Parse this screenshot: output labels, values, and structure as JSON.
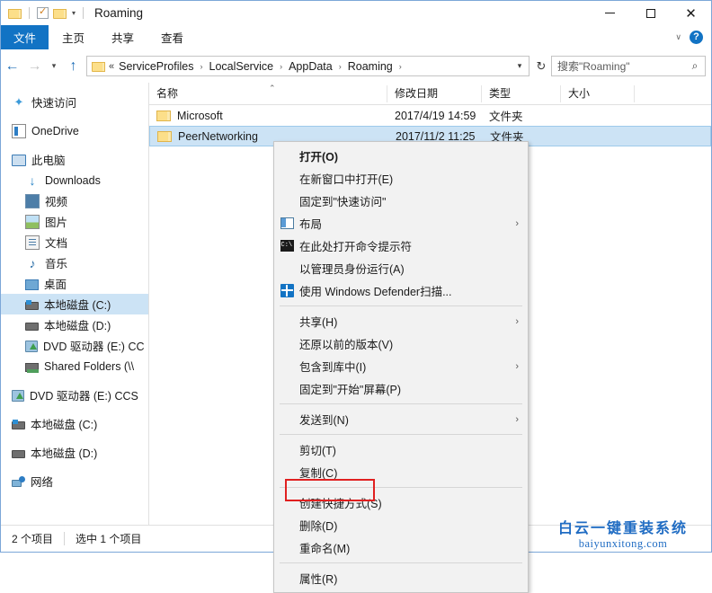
{
  "window": {
    "title": "Roaming",
    "quick_access": [
      {
        "name": "folder-icon",
        "label": "文件夹"
      },
      {
        "name": "properties-icon",
        "label": "属性"
      },
      {
        "name": "new-folder-icon",
        "label": "新建文件夹"
      },
      {
        "name": "customize-caret-icon",
        "label": "自定义快速访问工具栏"
      }
    ],
    "controls": {
      "minimize": "—",
      "maximize": "□",
      "close": "✕"
    }
  },
  "ribbon": {
    "tabs": [
      {
        "label": "文件",
        "active": true
      },
      {
        "label": "主页",
        "active": false
      },
      {
        "label": "共享",
        "active": false
      },
      {
        "label": "查看",
        "active": false
      }
    ],
    "collapse_icon": "∨",
    "help_icon": "?"
  },
  "address": {
    "back_icon": "←",
    "forward_icon": "→",
    "recent_icon": "∨",
    "up_icon": "↑",
    "lead": "«",
    "breadcrumbs": [
      "ServiceProfiles",
      "LocalService",
      "AppData",
      "Roaming"
    ],
    "separator": "›",
    "dropdown_icon": "∨",
    "refresh_icon": "↻",
    "search_placeholder": "搜索\"Roaming\"",
    "search_icon": "⌕"
  },
  "sidebar": {
    "items": [
      {
        "label": "快速访问",
        "icon": "star-icon",
        "indent": false,
        "selected": false,
        "gap": false
      },
      {
        "label": "OneDrive",
        "icon": "onedrive-icon",
        "indent": false,
        "selected": false,
        "gap": true
      },
      {
        "label": "此电脑",
        "icon": "this-pc-icon",
        "indent": false,
        "selected": false,
        "gap": true
      },
      {
        "label": "Downloads",
        "icon": "downloads-icon",
        "indent": true,
        "selected": false,
        "gap": false
      },
      {
        "label": "视频",
        "icon": "videos-icon",
        "indent": true,
        "selected": false,
        "gap": false
      },
      {
        "label": "图片",
        "icon": "pictures-icon",
        "indent": true,
        "selected": false,
        "gap": false
      },
      {
        "label": "文档",
        "icon": "documents-icon",
        "indent": true,
        "selected": false,
        "gap": false
      },
      {
        "label": "音乐",
        "icon": "music-icon",
        "indent": true,
        "selected": false,
        "gap": false
      },
      {
        "label": "桌面",
        "icon": "desktop-icon",
        "indent": true,
        "selected": false,
        "gap": false
      },
      {
        "label": "本地磁盘 (C:)",
        "icon": "system-drive-icon",
        "indent": true,
        "selected": true,
        "gap": false
      },
      {
        "label": "本地磁盘 (D:)",
        "icon": "drive-icon",
        "indent": true,
        "selected": false,
        "gap": false
      },
      {
        "label": "DVD 驱动器 (E:) CC",
        "icon": "dvd-drive-icon",
        "indent": true,
        "selected": false,
        "gap": false
      },
      {
        "label": "Shared Folders (\\\\",
        "icon": "shared-folder-icon",
        "indent": true,
        "selected": false,
        "gap": false
      },
      {
        "label": "DVD 驱动器 (E:) CCS",
        "icon": "dvd-drive-icon",
        "indent": false,
        "selected": false,
        "gap": true
      },
      {
        "label": "本地磁盘 (C:)",
        "icon": "system-drive-icon",
        "indent": false,
        "selected": false,
        "gap": true
      },
      {
        "label": "本地磁盘 (D:)",
        "icon": "drive-icon",
        "indent": false,
        "selected": false,
        "gap": true
      },
      {
        "label": "网络",
        "icon": "network-icon",
        "indent": false,
        "selected": false,
        "gap": true
      }
    ]
  },
  "filelist": {
    "columns": [
      {
        "key": "name",
        "label": "名称"
      },
      {
        "key": "date",
        "label": "修改日期"
      },
      {
        "key": "type",
        "label": "类型"
      },
      {
        "key": "size",
        "label": "大小"
      }
    ],
    "sort_indicator": "⌃",
    "rows": [
      {
        "name": "Microsoft",
        "date": "2017/4/19 14:59",
        "type": "文件夹",
        "size": "",
        "selected": false
      },
      {
        "name": "PeerNetworking",
        "date": "2017/11/2 11:25",
        "type": "文件夹",
        "size": "",
        "selected": true
      }
    ]
  },
  "context_menu": {
    "items": [
      {
        "label": "打开(O)",
        "icon": "",
        "bold": true,
        "submenu": false,
        "sep_after": false
      },
      {
        "label": "在新窗口中打开(E)",
        "icon": "",
        "bold": false,
        "submenu": false,
        "sep_after": false
      },
      {
        "label": "固定到\"快速访问\"",
        "icon": "",
        "bold": false,
        "submenu": false,
        "sep_after": false
      },
      {
        "label": "布局",
        "icon": "layout-icon",
        "bold": false,
        "submenu": true,
        "sep_after": false
      },
      {
        "label": "在此处打开命令提示符",
        "icon": "command-prompt-icon",
        "bold": false,
        "submenu": false,
        "sep_after": false
      },
      {
        "label": "以管理员身份运行(A)",
        "icon": "",
        "bold": false,
        "submenu": false,
        "sep_after": false
      },
      {
        "label": "使用 Windows Defender扫描...",
        "icon": "shield-icon",
        "bold": false,
        "submenu": false,
        "sep_after": true
      },
      {
        "label": "共享(H)",
        "icon": "",
        "bold": false,
        "submenu": true,
        "sep_after": false
      },
      {
        "label": "还原以前的版本(V)",
        "icon": "",
        "bold": false,
        "submenu": false,
        "sep_after": false
      },
      {
        "label": "包含到库中(I)",
        "icon": "",
        "bold": false,
        "submenu": true,
        "sep_after": false
      },
      {
        "label": "固定到\"开始\"屏幕(P)",
        "icon": "",
        "bold": false,
        "submenu": false,
        "sep_after": true
      },
      {
        "label": "发送到(N)",
        "icon": "",
        "bold": false,
        "submenu": true,
        "sep_after": true
      },
      {
        "label": "剪切(T)",
        "icon": "",
        "bold": false,
        "submenu": false,
        "sep_after": false
      },
      {
        "label": "复制(C)",
        "icon": "",
        "bold": false,
        "submenu": false,
        "sep_after": true
      },
      {
        "label": "创建快捷方式(S)",
        "icon": "",
        "bold": false,
        "submenu": false,
        "sep_after": false
      },
      {
        "label": "删除(D)",
        "icon": "",
        "bold": false,
        "submenu": false,
        "sep_after": false,
        "highlighted": true
      },
      {
        "label": "重命名(M)",
        "icon": "",
        "bold": false,
        "submenu": false,
        "sep_after": true
      },
      {
        "label": "属性(R)",
        "icon": "",
        "bold": false,
        "submenu": false,
        "sep_after": false
      }
    ],
    "submenu_arrow": "›",
    "highlight_color": "#e02020"
  },
  "statusbar": {
    "item_count": "2 个项目",
    "selection": "选中 1 个项目"
  },
  "watermark": {
    "cn": "白云一键重装系统",
    "en": "baiyunxitong.com"
  }
}
